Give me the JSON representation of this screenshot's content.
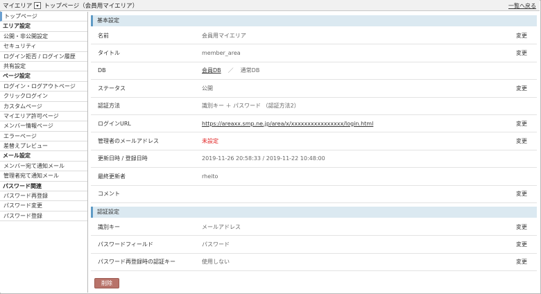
{
  "topbar": {
    "area": "マイエリア",
    "page": "トップページ（会員用マイエリア）",
    "back_link": "一覧へ戻る"
  },
  "sidebar": {
    "top": "トップページ",
    "groups": [
      {
        "heading": "エリア設定",
        "items": [
          "公開・非公開設定",
          "セキュリティ",
          "ログイン拒否 / ログイン履歴",
          "共有設定"
        ]
      },
      {
        "heading": "ページ設定",
        "items": [
          "ログイン・ログアウトページ",
          "クリックログイン",
          "カスタムページ",
          "マイエリア許可ページ",
          "メンバー情報ページ",
          "エラーページ",
          "差替えプレビュー"
        ]
      },
      {
        "heading": "メール設定",
        "items": [
          "メンバー宛て通知メール",
          "管理者宛て通知メール"
        ]
      },
      {
        "heading": "パスワード関連",
        "items": [
          "パスワード再登録",
          "パスワード変更",
          "パスワード登録"
        ]
      }
    ]
  },
  "basic": {
    "heading": "基本設定",
    "change_label": "変更",
    "name_label": "名前",
    "name_value": "会員用マイエリア",
    "title_label": "タイトル",
    "title_value": "member_area",
    "db_label": "DB",
    "db_member": "会員DB",
    "db_sep": "／",
    "db_normal": "通常DB",
    "status_label": "ステータス",
    "status_value": "公開",
    "auth_label": "認証方法",
    "auth_value": "識別キー ＋ パスワード （認証方法2）",
    "url_label": "ログインURL",
    "url_value": "https://areaxx.smp.ne.jp/area/x/xxxxxxxxxxxxxxxx/login.html",
    "email_label": "管理者のメールアドレス",
    "email_value": "未設定",
    "dates_label": "更新日時 / 登録日時",
    "dates_value": "2019-11-26 20:58:33 / 2019-11-22 10:48:00",
    "updater_label": "最終更新者",
    "updater_value": "rheito",
    "comment_label": "コメント",
    "comment_value": ""
  },
  "auth": {
    "heading": "認証設定",
    "id_label": "識別キー",
    "id_value": "メールアドレス",
    "pw_label": "パスワードフィールド",
    "pw_value": "パスワード",
    "rereg_label": "パスワード再登録時の認証キー",
    "rereg_value": "使用しない"
  },
  "delete_label": "削除"
}
